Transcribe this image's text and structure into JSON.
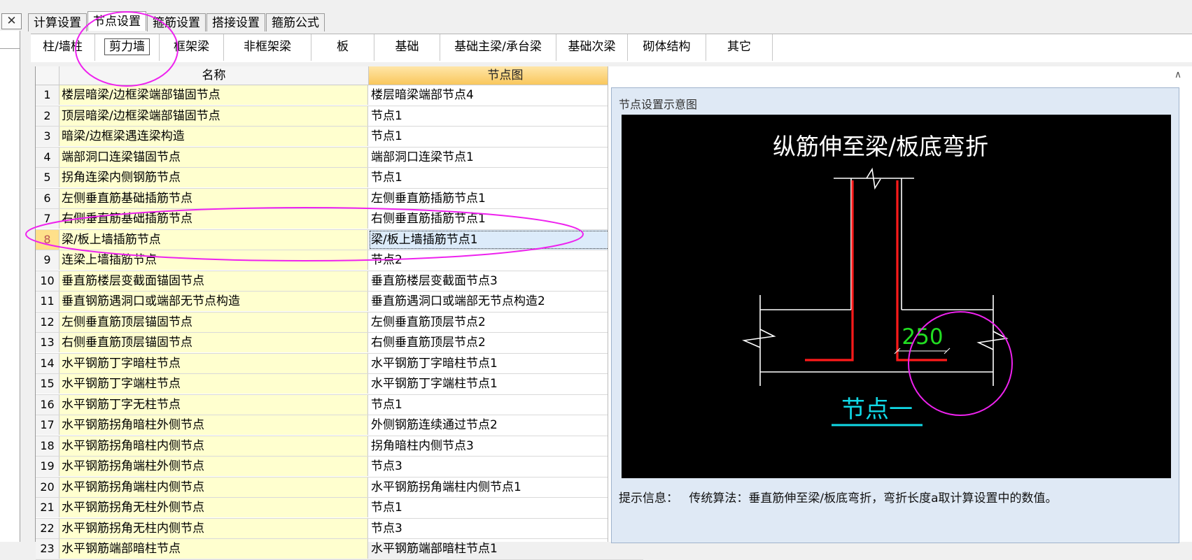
{
  "window": {
    "close_glyph": "✕"
  },
  "top_tabs": [
    "计算设置",
    "节点设置",
    "箍筋设置",
    "搭接设置",
    "箍筋公式"
  ],
  "top_tab_active": 1,
  "sub_tabs": [
    "柱/墙柱",
    "剪力墙",
    "框架梁",
    "非框架梁",
    "板",
    "基础",
    "基础主梁/承台梁",
    "基础次梁",
    "砌体结构",
    "其它"
  ],
  "sub_tab_active": 1,
  "grid": {
    "headers": {
      "name": "名称",
      "node": "节点图"
    },
    "selected_row": 8,
    "rows": [
      {
        "num": "1",
        "name": "楼层暗梁/边框梁端部锚固节点",
        "node": "楼层暗梁端部节点4"
      },
      {
        "num": "2",
        "name": "顶层暗梁/边框梁端部锚固节点",
        "node": "节点1"
      },
      {
        "num": "3",
        "name": "暗梁/边框梁遇连梁构造",
        "node": "节点1"
      },
      {
        "num": "4",
        "name": "端部洞口连梁锚固节点",
        "node": "端部洞口连梁节点1"
      },
      {
        "num": "5",
        "name": "拐角连梁内侧钢筋节点",
        "node": "节点1"
      },
      {
        "num": "6",
        "name": "左侧垂直筋基础插筋节点",
        "node": "左侧垂直筋插筋节点1"
      },
      {
        "num": "7",
        "name": "右侧垂直筋基础插筋节点",
        "node": "右侧垂直筋插筋节点1"
      },
      {
        "num": "8",
        "name": "梁/板上墙插筋节点",
        "node": "梁/板上墙插筋节点1"
      },
      {
        "num": "9",
        "name": "连梁上墙插筋节点",
        "node": "节点2"
      },
      {
        "num": "10",
        "name": "垂直筋楼层变截面锚固节点",
        "node": "垂直筋楼层变截面节点3"
      },
      {
        "num": "11",
        "name": "垂直钢筋遇洞口或端部无节点构造",
        "node": "垂直筋遇洞口或端部无节点构造2"
      },
      {
        "num": "12",
        "name": "左侧垂直筋顶层锚固节点",
        "node": "左侧垂直筋顶层节点2"
      },
      {
        "num": "13",
        "name": "右侧垂直筋顶层锚固节点",
        "node": "右侧垂直筋顶层节点2"
      },
      {
        "num": "14",
        "name": "水平钢筋丁字暗柱节点",
        "node": "水平钢筋丁字暗柱节点1"
      },
      {
        "num": "15",
        "name": "水平钢筋丁字端柱节点",
        "node": "水平钢筋丁字端柱节点1"
      },
      {
        "num": "16",
        "name": "水平钢筋丁字无柱节点",
        "node": "节点1"
      },
      {
        "num": "17",
        "name": "水平钢筋拐角暗柱外侧节点",
        "node": "外侧钢筋连续通过节点2"
      },
      {
        "num": "18",
        "name": "水平钢筋拐角暗柱内侧节点",
        "node": "拐角暗柱内侧节点3"
      },
      {
        "num": "19",
        "name": "水平钢筋拐角端柱外侧节点",
        "node": "节点3"
      },
      {
        "num": "20",
        "name": "水平钢筋拐角端柱内侧节点",
        "node": "水平钢筋拐角端柱内侧节点1"
      },
      {
        "num": "21",
        "name": "水平钢筋拐角无柱外侧节点",
        "node": "节点1"
      },
      {
        "num": "22",
        "name": "水平钢筋拐角无柱内侧节点",
        "node": "节点3"
      },
      {
        "num": "23",
        "name": "水平钢筋端部暗柱节点",
        "node": "水平钢筋端部暗柱节点1"
      }
    ]
  },
  "diagram": {
    "panel_title": "节点设置示意图",
    "heading": "纵筋伸至梁/板底弯折",
    "dimension": "250",
    "node_label": "节点一",
    "colors": {
      "background": "#000000",
      "lines": "#ffffff",
      "rebar": "#ff1a1a",
      "dimension": "#22dd22",
      "label": "#11d9e6"
    }
  },
  "hint": {
    "label": "提示信息：",
    "text": "传统算法：垂直筋伸至梁/板底弯折，弯折长度a取计算设置中的数值。"
  },
  "annotations": {
    "color": "#ee22ee"
  },
  "scroll_up_glyph": "∧"
}
